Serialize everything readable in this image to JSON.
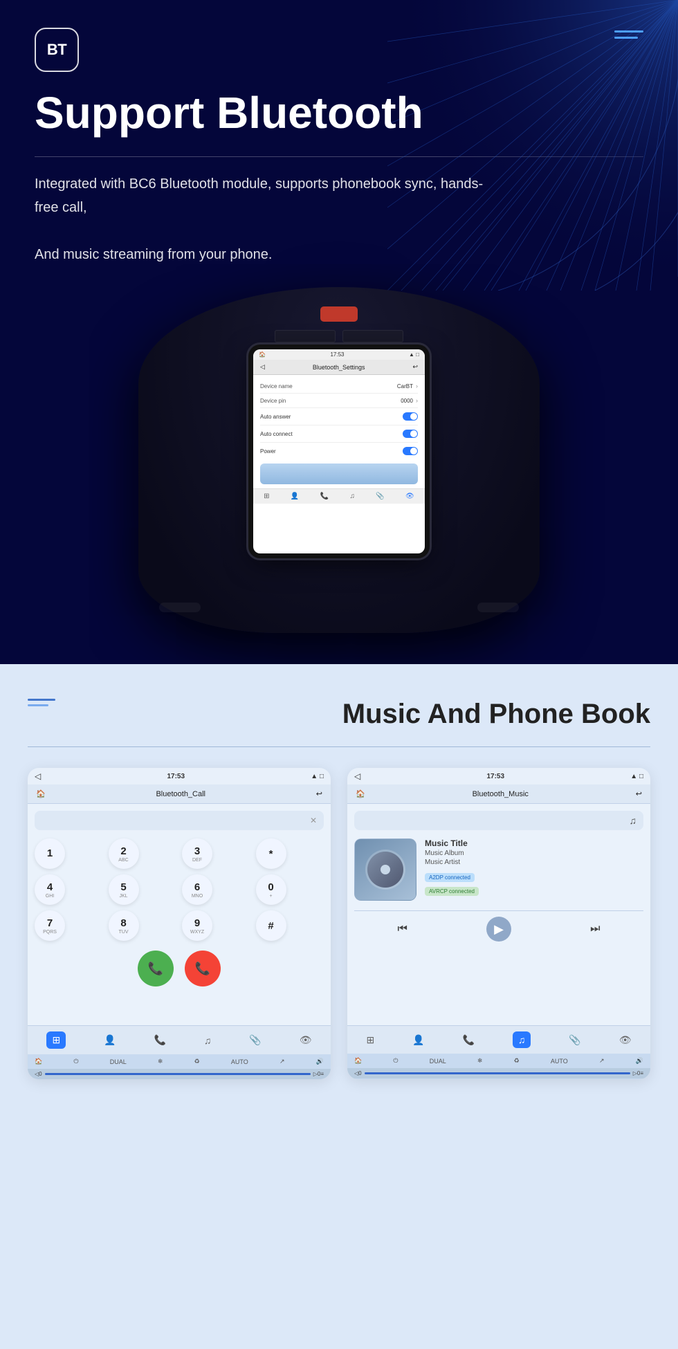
{
  "hero": {
    "logo_text": "BT",
    "title": "Support Bluetooth",
    "description_line1": "Integrated with BC6 Bluetooth module, supports phonebook sync, hands-free call,",
    "description_line2": "And music streaming from your phone.",
    "screen": {
      "time": "17:53",
      "title": "Bluetooth_Settings",
      "device_name_label": "Device name",
      "device_name_value": "CarBT",
      "device_pin_label": "Device pin",
      "device_pin_value": "0000",
      "auto_answer_label": "Auto answer",
      "auto_connect_label": "Auto connect",
      "power_label": "Power"
    }
  },
  "bottom": {
    "title": "Music And Phone Book",
    "divider": true,
    "call_screen": {
      "time": "17:53",
      "title": "Bluetooth_Call",
      "keys": [
        {
          "main": "1",
          "sub": ""
        },
        {
          "main": "2",
          "sub": "ABC"
        },
        {
          "main": "3",
          "sub": "DEF"
        },
        {
          "main": "*",
          "sub": ""
        },
        {
          "main": "4",
          "sub": "GHI"
        },
        {
          "main": "5",
          "sub": "JKL"
        },
        {
          "main": "6",
          "sub": "MNO"
        },
        {
          "main": "0",
          "sub": "+"
        },
        {
          "main": "7",
          "sub": "PQRS"
        },
        {
          "main": "8",
          "sub": "TUV"
        },
        {
          "main": "9",
          "sub": "WXYZ"
        },
        {
          "main": "#",
          "sub": ""
        }
      ]
    },
    "music_screen": {
      "time": "17:53",
      "title": "Bluetooth_Music",
      "music_title": "Music Title",
      "music_album": "Music Album",
      "music_artist": "Music Artist",
      "badge1": "A2DP connected",
      "badge2": "AVRCP connected"
    }
  }
}
